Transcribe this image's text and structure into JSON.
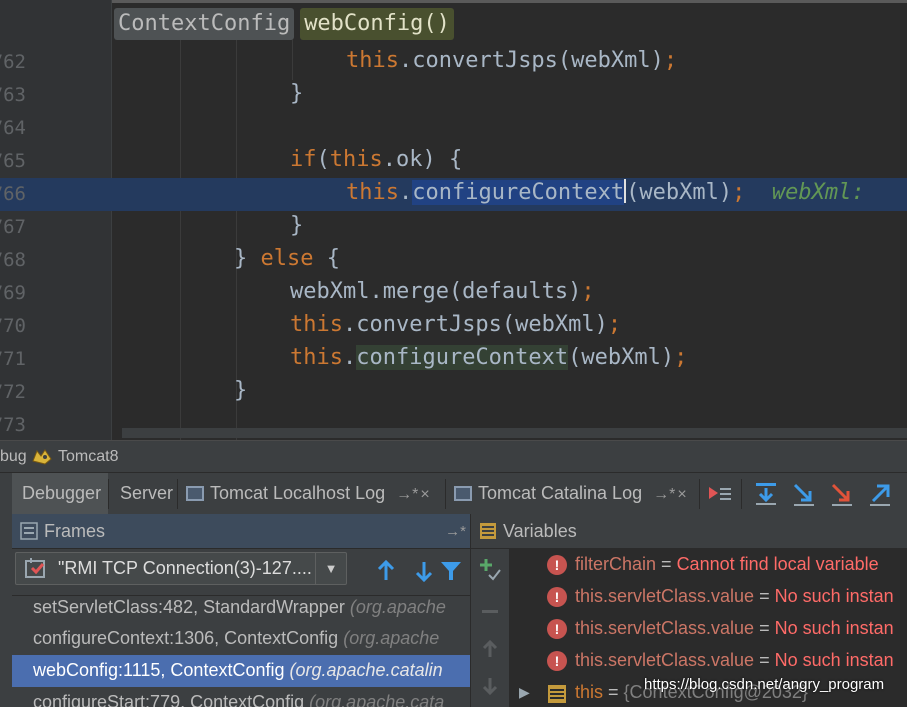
{
  "editor": {
    "breadcrumbs": [
      "ContextConfig",
      "webConfig()"
    ],
    "lines": [
      {
        "num": "762",
        "text": "this.convertJsps(webXml);"
      },
      {
        "num": "763",
        "text": "}"
      },
      {
        "num": "764",
        "text": ""
      },
      {
        "num": "765",
        "text": "if(this.ok) {"
      },
      {
        "num": "766",
        "text": "this.configureContext(webXml);",
        "hint": "webXml: "
      },
      {
        "num": "767",
        "text": "}"
      },
      {
        "num": "768",
        "text": "} else {"
      },
      {
        "num": "769",
        "text": "webXml.merge(defaults);"
      },
      {
        "num": "770",
        "text": "this.convertJsps(webXml);"
      },
      {
        "num": "771",
        "text": "this.configureContext(webXml);"
      },
      {
        "num": "772",
        "text": "}"
      },
      {
        "num": "773",
        "text": ""
      }
    ]
  },
  "debug": {
    "title_prefix": "bug",
    "config_name": "Tomcat8",
    "tabs": {
      "debugger": "Debugger",
      "server": "Server",
      "localhost_log": "Tomcat Localhost Log",
      "catalina_log": "Tomcat Catalina Log",
      "pin_glyph": "→*",
      "close_glyph": "×"
    }
  },
  "frames": {
    "title": "Frames",
    "pin_glyph": "→*",
    "thread": "\"RMI TCP Connection(3)-127....",
    "items": [
      {
        "method": "setServletClass:482, StandardWrapper ",
        "pkg": "(org.apache"
      },
      {
        "method": "configureContext:1306, ContextConfig ",
        "pkg": "(org.apache"
      },
      {
        "method": "webConfig:1115, ContextConfig ",
        "pkg": "(org.apache.catalin"
      },
      {
        "method": "configureStart:779, ContextConfig ",
        "pkg": "(org.apache.cata"
      }
    ]
  },
  "variables": {
    "title": "Variables",
    "items": [
      {
        "name": "filterChain",
        "eq": " = ",
        "value": "Cannot find local variable"
      },
      {
        "name": "this.servletClass.value",
        "eq": " = ",
        "value": "No such instan"
      },
      {
        "name": "this.servletClass.value",
        "eq": " = ",
        "value": "No such instan"
      },
      {
        "name": "this.servletClass.value",
        "eq": " = ",
        "value": "No such instan"
      }
    ],
    "this_row": {
      "name": "this",
      "eq": " = ",
      "value": "{ContextConfig@2032}"
    }
  },
  "watermark": "https://blog.csdn.net/angry_program",
  "colors": {
    "background": "#2b2b2b",
    "keyword": "#cc7832",
    "selection": "#214283",
    "current_line": "#243a5e",
    "frame_selected": "#4b6eaf",
    "error": "#ff6b68",
    "hint": "#629755"
  }
}
